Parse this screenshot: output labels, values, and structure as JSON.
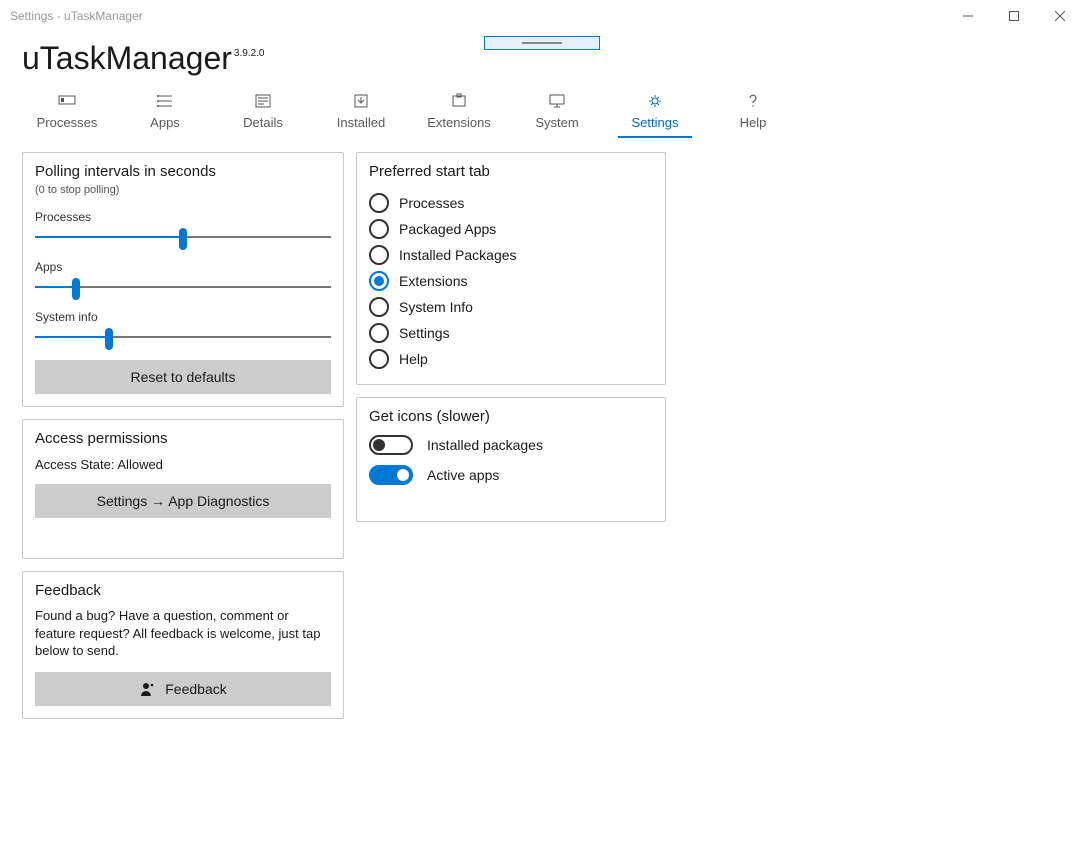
{
  "window": {
    "title": "Settings - uTaskManager"
  },
  "app": {
    "name": "uTaskManager",
    "version": "3.9.2.0"
  },
  "tabs": [
    {
      "label": "Processes"
    },
    {
      "label": "Apps"
    },
    {
      "label": "Details"
    },
    {
      "label": "Installed"
    },
    {
      "label": "Extensions"
    },
    {
      "label": "System"
    },
    {
      "label": "Settings",
      "active": true
    },
    {
      "label": "Help"
    }
  ],
  "polling": {
    "title": "Polling intervals in seconds",
    "subtitle": "(0 to stop polling)",
    "sliders": {
      "processes": {
        "label": "Processes",
        "percent": 50
      },
      "apps": {
        "label": "Apps",
        "percent": 14
      },
      "system": {
        "label": "System info",
        "percent": 25
      }
    },
    "reset_label": "Reset to defaults"
  },
  "access": {
    "title": "Access permissions",
    "state_label": "Access State:",
    "state_value": "Allowed",
    "button_label": "Settings → App Diagnostics"
  },
  "feedback": {
    "title": "Feedback",
    "body": "Found a bug? Have a question, comment or feature request? All feedback is welcome, just tap below to send.",
    "button_label": "Feedback"
  },
  "starttab": {
    "title": "Preferred start tab",
    "options": [
      "Processes",
      "Packaged Apps",
      "Installed Packages",
      "Extensions",
      "System Info",
      "Settings",
      "Help"
    ],
    "selected": "Extensions"
  },
  "icons": {
    "title": "Get icons (slower)",
    "installed": {
      "label": "Installed packages",
      "on": false
    },
    "active": {
      "label": "Active apps",
      "on": true
    }
  }
}
